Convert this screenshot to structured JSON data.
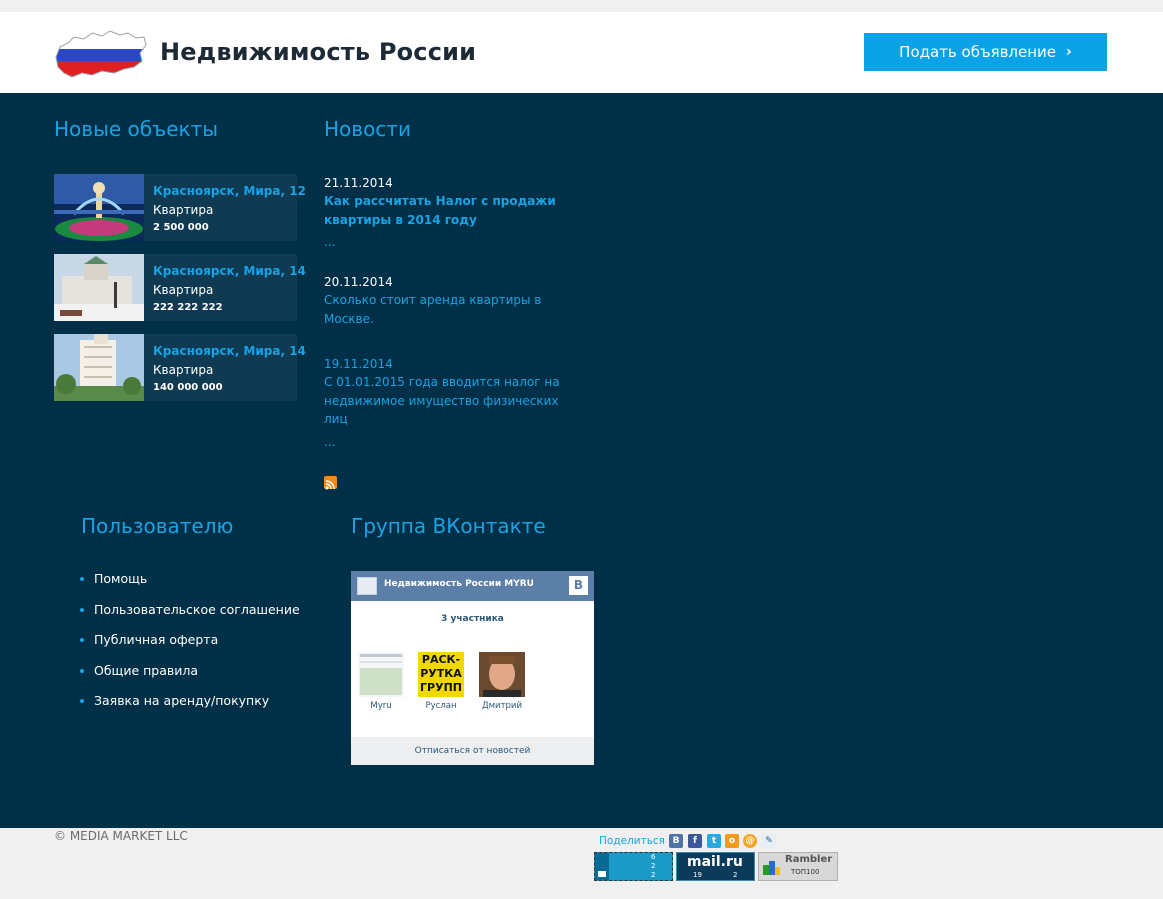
{
  "header": {
    "site_title": "Недвижимость России",
    "post_button_label": "Подать объявление",
    "logo_icon": "russia-flag-map-icon"
  },
  "new_objects": {
    "title": "Новые объекты",
    "items": [
      {
        "address": "Красноярск, Мира, 12",
        "type": "Квартира",
        "price": "2 500 000"
      },
      {
        "address": "Красноярск, Мира, 14",
        "type": "Квартира",
        "price": "222 222 222"
      },
      {
        "address": "Красноярск, Мира, 14",
        "type": "Квартира",
        "price": "140 000 000"
      }
    ]
  },
  "news": {
    "title": "Новости",
    "items": [
      {
        "date": "21.11.2014",
        "title": "Как рассчитать Налог с продажи квартиры в 2014 году",
        "more": "..."
      },
      {
        "date": "20.11.2014",
        "title": "Сколько стоит аренда квартиры в Москве.",
        "more": ""
      },
      {
        "date": "19.11.2014",
        "title": "С 01.01.2015 года  вводится  налог на недвижимое имущество физических лиц",
        "more": "..."
      }
    ],
    "rss_icon": "rss-icon"
  },
  "user_section": {
    "title": "Пользователю",
    "links": [
      "Помощь",
      "Пользовательское соглашение",
      "Публичная оферта",
      "Общие правила",
      "Заявка на аренду/покупку"
    ]
  },
  "vk_group": {
    "title": "Группа ВКонтакте",
    "widget_name": "Недвижимость России MYRU",
    "vk_badge": "B",
    "members_count": "3 участника",
    "members": [
      {
        "name": "Myru"
      },
      {
        "name": "Руслан",
        "avatar_text_1": "РАСК-",
        "avatar_text_2": "РУТКА",
        "avatar_text_3": "ГРУПП"
      },
      {
        "name": "Дмитрий"
      }
    ],
    "unsubscribe": "Отписаться от новостей"
  },
  "footer": {
    "copyright": "© MEDIA MARKET LLC",
    "share_label": "Поделиться",
    "share_icons": [
      "vk-icon",
      "facebook-icon",
      "twitter-icon",
      "odnoklassniki-icon",
      "mailru-icon",
      "livejournal-icon"
    ],
    "counters": {
      "liveinternet": {
        "line1": "6",
        "line2": "2",
        "line3": "2"
      },
      "mailru": {
        "logo": "mail.ru",
        "left": "19",
        "right": "2"
      },
      "rambler": {
        "logo": "Rambler",
        "sub": "ТОП100"
      }
    }
  },
  "colors": {
    "accent": "#1aa2e2",
    "button": "#0aa3e8",
    "main_bg": "#003048",
    "header_bg": "#ffffff"
  }
}
